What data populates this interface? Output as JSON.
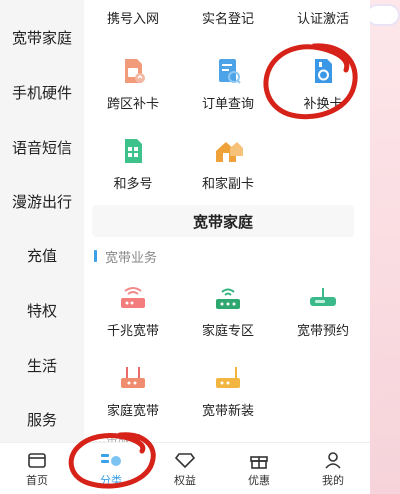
{
  "sidebar": {
    "items": [
      {
        "label": "宽带家庭"
      },
      {
        "label": "手机硬件"
      },
      {
        "label": "语音短信"
      },
      {
        "label": "漫游出行"
      },
      {
        "label": "充值"
      },
      {
        "label": "特权"
      },
      {
        "label": "生活"
      },
      {
        "label": "服务"
      }
    ]
  },
  "top_row": [
    "携号入网",
    "实名登记",
    "认证激活"
  ],
  "service_items": [
    {
      "label": "跨区补卡",
      "icon": "sim-swap-icon"
    },
    {
      "label": "订单查询",
      "icon": "order-search-icon"
    },
    {
      "label": "补换卡",
      "icon": "sim-replace-icon"
    },
    {
      "label": "和多号",
      "icon": "multi-number-sim-icon"
    },
    {
      "label": "和家副卡",
      "icon": "family-sub-card-icon"
    }
  ],
  "broadband": {
    "section_title": "宽带家庭",
    "sub_title": "宽带业务",
    "items": [
      {
        "label": "千兆宽带",
        "icon": "gigabit-router-icon"
      },
      {
        "label": "家庭专区",
        "icon": "home-zone-icon"
      },
      {
        "label": "宽带预约",
        "icon": "broadband-booking-icon"
      },
      {
        "label": "家庭宽带",
        "icon": "home-broadband-icon"
      },
      {
        "label": "宽带新装",
        "icon": "new-install-icon"
      }
    ],
    "next_section": "…带服务"
  },
  "tabbar": {
    "tabs": [
      {
        "label": "首页",
        "icon": "home-icon"
      },
      {
        "label": "分类",
        "icon": "category-icon"
      },
      {
        "label": "权益",
        "icon": "diamond-icon"
      },
      {
        "label": "优惠",
        "icon": "gift-icon"
      },
      {
        "label": "我的",
        "icon": "profile-icon"
      }
    ]
  },
  "colors": {
    "accent": "#3aa0e8",
    "annotation_red": "#d62218",
    "frame_pink": "#f3c9cf"
  }
}
